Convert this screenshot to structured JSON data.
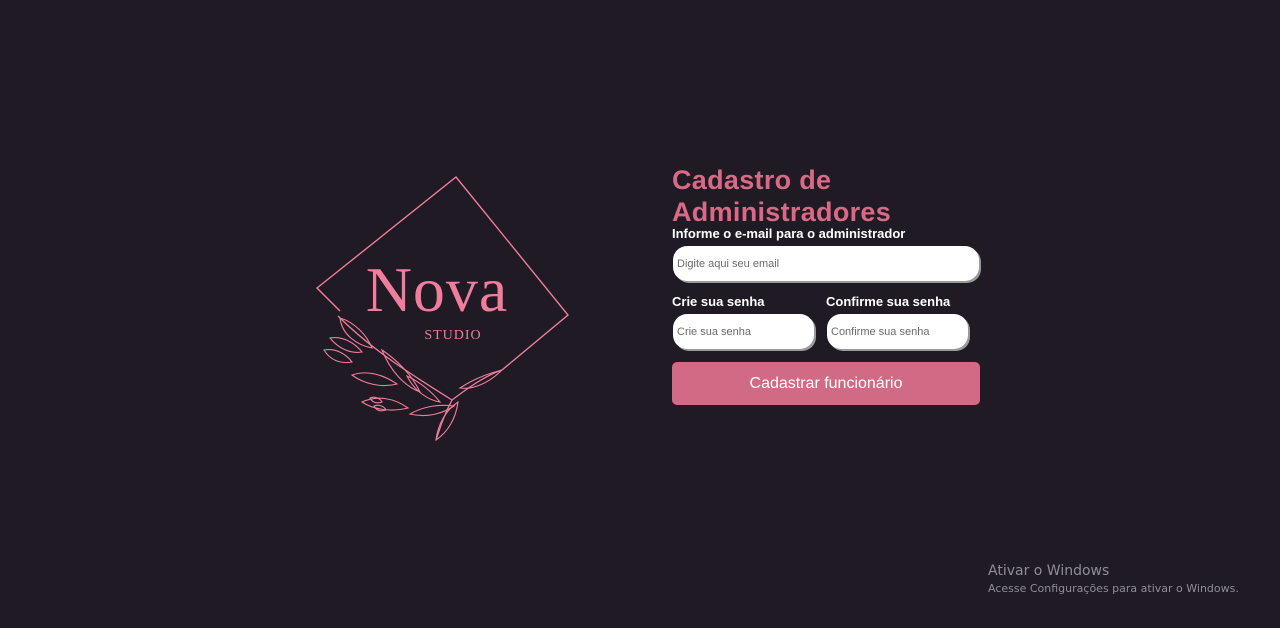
{
  "logo": {
    "wordmark": "Nova",
    "subtitle": "STUDIO",
    "accent_color": "#f07d9c"
  },
  "form": {
    "title": "Cadastro de Administradores",
    "email_label": "Informe o e-mail para o administrador",
    "email_placeholder": "Digite aqui seu email",
    "password_label": "Crie sua senha",
    "password_placeholder": "Crie sua senha",
    "confirm_label": "Confirme sua senha",
    "confirm_placeholder": "Confirme sua senha",
    "submit_label": "Cadastrar funcionário",
    "title_color": "#d86a86",
    "button_color": "#d16a84"
  },
  "watermark": {
    "title": "Ativar o Windows",
    "subtitle": "Acesse Configurações para ativar o Windows."
  },
  "theme": {
    "background": "#1f1a24"
  }
}
